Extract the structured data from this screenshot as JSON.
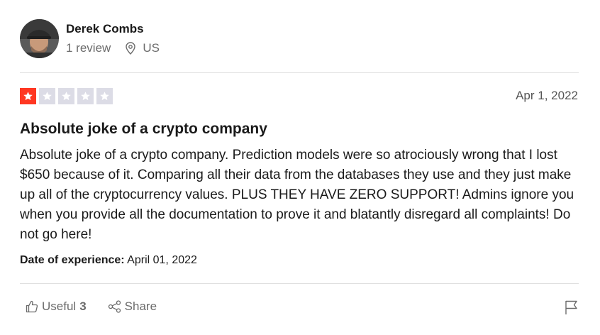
{
  "reviewer": {
    "name": "Derek Combs",
    "review_count": "1 review",
    "country": "US",
    "avatar_icon": "user-avatar-photo"
  },
  "rating": {
    "stars": 1,
    "max_stars": 5,
    "filled_color": "#ff3722",
    "empty_color": "#dcdce6"
  },
  "review": {
    "date": "Apr 1, 2022",
    "title": "Absolute joke of a crypto company",
    "body": "Absolute joke of a crypto company. Prediction models were so atrociously wrong that I lost $650 because of it. Comparing all their data from the databases they use and they just make up all of the cryptocurrency values. PLUS THEY HAVE ZERO SUPPORT! Admins ignore you when you provide all the documentation to prove it and blatantly disregard all complaints! Do not go here!",
    "experience_label": "Date of experience:",
    "experience_date": "April 01, 2022"
  },
  "actions": {
    "useful_label": "Useful",
    "useful_count": "3",
    "share_label": "Share",
    "icons": [
      "thumbs-up-icon",
      "share-icon",
      "flag-icon"
    ]
  }
}
